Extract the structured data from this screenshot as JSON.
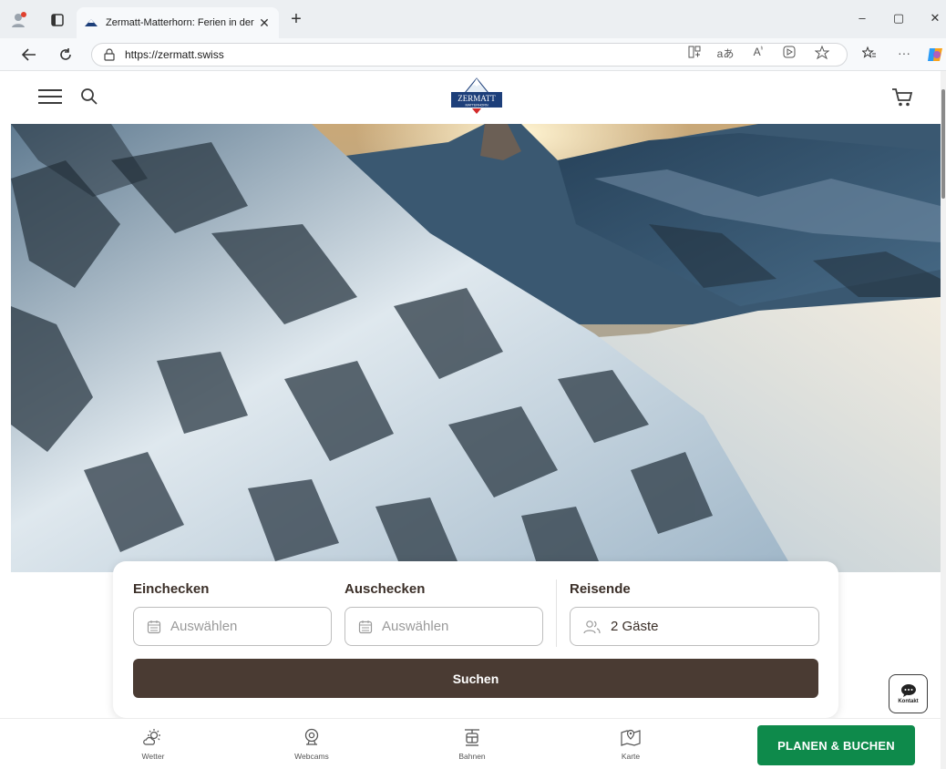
{
  "browser": {
    "tab_title": "Zermatt-Matterhorn: Ferien in der",
    "new_tab_label": "+",
    "url": "https://zermatt.swiss",
    "window_controls": {
      "minimize": "–",
      "maximize": "▢",
      "close": "✕"
    }
  },
  "site": {
    "logo_text_top": "ZERMATT",
    "logo_text_bottom": "MATTERHORN",
    "icons": [
      "menu-icon",
      "search-icon",
      "cart-icon"
    ]
  },
  "booking": {
    "checkin_label": "Einchecken",
    "checkin_placeholder": "Auswählen",
    "checkout_label": "Auschecken",
    "checkout_placeholder": "Auswählen",
    "guests_label": "Reisende",
    "guests_value": "2 Gäste",
    "search_button": "Suchen"
  },
  "kontakt_label": "Kontakt",
  "bottom_nav": {
    "items": [
      {
        "label": "Wetter",
        "icon": "weather-icon"
      },
      {
        "label": "Webcams",
        "icon": "webcam-icon"
      },
      {
        "label": "Bahnen",
        "icon": "cablecar-icon"
      },
      {
        "label": "Karte",
        "icon": "map-icon"
      }
    ],
    "cta": "PLANEN & BUCHEN"
  },
  "colors": {
    "brand_dark": "#4a3b33",
    "cta_green": "#0e8a4b",
    "logo_blue": "#1d3f7a"
  }
}
